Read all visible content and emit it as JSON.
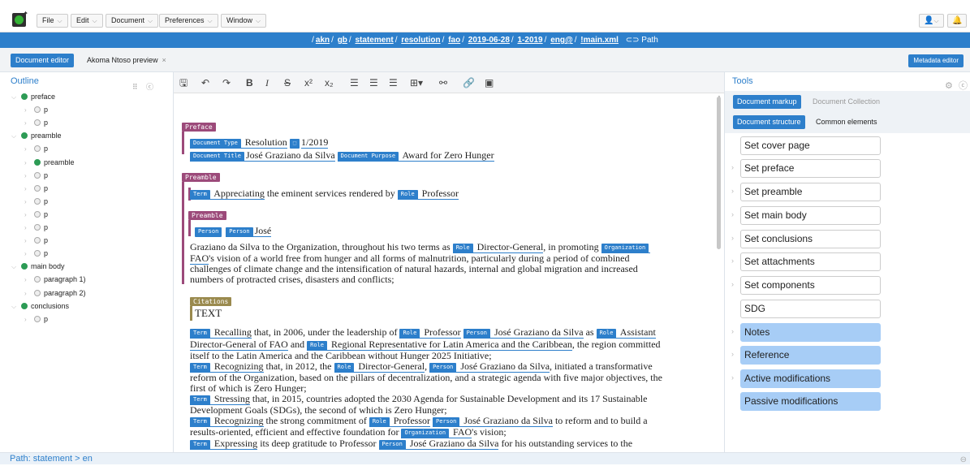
{
  "menubar": {
    "menus": [
      "File",
      "Edit",
      "Document",
      "Preferences",
      "Window"
    ]
  },
  "pathbar": {
    "segments": [
      "akn",
      "gb",
      "statement",
      "resolution",
      "fao",
      "2019-06-28",
      "1-2019",
      "eng@",
      "!main.xml"
    ],
    "path_label": "Path"
  },
  "tabs": {
    "doc_editor": "Document editor",
    "akn_preview": "Akoma Ntoso preview",
    "close": "×",
    "metadata": "Metadata editor"
  },
  "outline": {
    "title": "Outline",
    "nodes": [
      {
        "label": "preface",
        "depth": 0,
        "filled": true,
        "expanded": true
      },
      {
        "label": "p",
        "depth": 1,
        "filled": false
      },
      {
        "label": "p",
        "depth": 1,
        "filled": false
      },
      {
        "label": "preamble",
        "depth": 0,
        "filled": true,
        "expanded": true
      },
      {
        "label": "p",
        "depth": 1,
        "filled": false
      },
      {
        "label": "preamble",
        "depth": 1,
        "filled": true
      },
      {
        "label": "p",
        "depth": 1,
        "filled": false
      },
      {
        "label": "p",
        "depth": 1,
        "filled": false
      },
      {
        "label": "p",
        "depth": 1,
        "filled": false
      },
      {
        "label": "p",
        "depth": 1,
        "filled": false
      },
      {
        "label": "p",
        "depth": 1,
        "filled": false
      },
      {
        "label": "p",
        "depth": 1,
        "filled": false
      },
      {
        "label": "p",
        "depth": 1,
        "filled": false
      },
      {
        "label": "main body",
        "depth": 0,
        "filled": true,
        "expanded": true
      },
      {
        "label": "paragraph 1)",
        "depth": 1,
        "filled": false
      },
      {
        "label": "paragraph 2)",
        "depth": 1,
        "filled": false
      },
      {
        "label": "conclusions",
        "depth": 0,
        "filled": true,
        "expanded": true
      },
      {
        "label": "p",
        "depth": 1,
        "filled": false
      }
    ]
  },
  "document": {
    "preface_label": "Preface",
    "doc_type_tag": "Document Type",
    "doc_type": "Resolution",
    "doc_number": "1/2019",
    "doc_title_tag": "Document Title",
    "doc_title": "José Graziano da Silva",
    "doc_purpose_tag": "Document Purpose",
    "doc_purpose": "Award for Zero Hunger",
    "preamble_label": "Preamble",
    "term_tag": "Term",
    "role_tag": "Role",
    "person_tag": "Person",
    "org_tag": "Organization",
    "appreciating": "Appreciating",
    "appreciating_rest": "the eminent services rendered by",
    "professor": "Professor",
    "inner_preamble_label": "Preamble",
    "jose": "José",
    "para1_a": "Graziano da Silva to the Organization, throughout his two terms as",
    "director_general": "Director-General",
    "para1_b": ", in promoting",
    "fao": "FAO",
    "para1_c": "'s vision of a world free from hunger and all forms of malnutrition, particularly during a period of combined",
    "para1_d": "challenges of climate change and the intensification of natural hazards, internal and global migration and increased",
    "para1_e": "numbers of protracted crises, disasters and conflicts;",
    "citations_label": "Citations",
    "citations_text": "TEXT",
    "recalling": "Recalling",
    "recalling_a": "that, in 2006, under the leadership of",
    "jose_full": "José Graziano da Silva",
    "as": "as",
    "assistant_dg": "Assistant",
    "assistant_dg_2": "Director-General of FAO",
    "and": "and",
    "regional_rep": "Regional Representative for Latin America and the Caribbean",
    "recalling_b": ", the region committed",
    "recalling_c": "itself to the Latin America and the Caribbean without Hunger 2025 Initiative;",
    "recognizing": "Recognizing",
    "recognizing_a": "that, in 2012, the",
    "recognizing_b": ", initiated a transformative",
    "recognizing_c": "reform of the Organization, based on the pillars of decentralization, and a strategic agenda with five major objectives, the",
    "recognizing_d": "first of which is Zero Hunger;",
    "stressing": "Stressing",
    "stressing_a": "that, in 2015, countries adopted the 2030 Agenda for Sustainable Development and its 17 Sustainable",
    "stressing_b": "Development Goals (SDGs), the second of which is Zero Hunger;",
    "recognizing2_a": "the strong commitment of",
    "recognizing2_b": "to reform and to build a",
    "recognizing2_c": "results-oriented, efficient and effective foundation for",
    "recognizing2_d": "'s vision;",
    "expressing": "Expressing",
    "expressing_a": "its deep gratitude to Professor",
    "expressing_b": "for his outstanding services to the"
  },
  "tools": {
    "title": "Tools",
    "tab_markup": "Document markup",
    "tab_collection": "Document Collection",
    "tab_structure": "Document structure",
    "tab_common": "Common elements",
    "buttons": [
      "Set cover page",
      "Set preface",
      "Set preamble",
      "Set main body",
      "Set conclusions",
      "Set attachments",
      "Set components",
      "SDG",
      "Notes",
      "Reference",
      "Active modifications",
      "Passive modifications"
    ]
  },
  "statusbar": {
    "path": "Path: statement > en"
  },
  "colors": {
    "accent": "#2d7fcb",
    "preface_label": "#9c4a7a",
    "citations_label": "#9a8a4e",
    "tool_highlight": "#a7cdf6",
    "node_filled": "#2d9b55"
  }
}
